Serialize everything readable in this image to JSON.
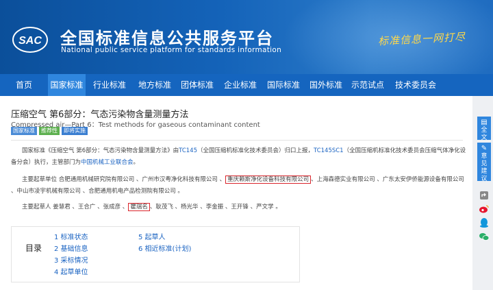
{
  "header": {
    "logo_text": "SAC",
    "title": "全国标准信息公共服务平台",
    "subtitle": "National public service platform  for standards information",
    "slogan": "标准信息一网打尽"
  },
  "nav": {
    "items": [
      "首页",
      "国家标准",
      "行业标准",
      "地方标准",
      "团体标准",
      "企业标准",
      "国际标准",
      "国外标准",
      "示范试点",
      "技术委员会"
    ],
    "active": "国家标准"
  },
  "standard": {
    "title": "压缩空气 第6部分：气态污染物含量测量方法",
    "en_title": "Compressed air—Part 6：Test methods for gaseous contaminant content",
    "badges": [
      "国家标准",
      "推荐性",
      "即将实施"
    ],
    "intro": {
      "p1": "国家标准《压缩空气 第6部分：气态污染物含量测量方法》由",
      "tc1": "TC145",
      "p2": "（全国压缩机标准化技术委员会）归口上报，",
      "tc2": "TC145SC1",
      "p3": "（全国压缩机标准化技术委员会压缩气体净化设备分会）执行，主管部门为",
      "dept": "中国机械工业联合会",
      "p4": "。"
    },
    "drafting_units": {
      "before": "主要起草单位 合肥通用机械研究院有限公司 、广州市汉粤净化科技有限公司 、",
      "highlight": "重庆赖斯净化设备科技有限公司",
      "after": "、上海森德实业有限公司 、广东太安伊侨能源设备有限公司 、中山市凌宇机械有限公司 、合肥通用机电产品检测院有限公司 。"
    },
    "drafters": {
      "before": "主要起草人 姜慧君 、王合广 、张成彦 、",
      "highlight": "瞿瑞名",
      "after": "、耿茂飞 、杨光华 、李金振 、王开锋 、严文学 。"
    }
  },
  "toc": {
    "label": "目录",
    "left": [
      "1  标准状态",
      "2  基础信息",
      "3  采标情况",
      "4  起草单位"
    ],
    "right": [
      "5  起草人",
      "6  相近标准(计划)"
    ]
  },
  "sidebar": {
    "fulltext": "全文",
    "feedback": "意见建议"
  }
}
